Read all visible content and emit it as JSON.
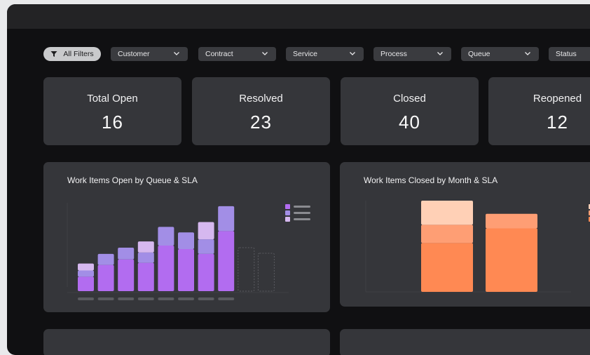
{
  "filters": {
    "all_filters_label": "All Filters",
    "dropdowns": [
      "Customer",
      "Contract",
      "Service",
      "Process",
      "Queue",
      "Status"
    ]
  },
  "kpis": [
    {
      "label": "Total Open",
      "value": "16"
    },
    {
      "label": "Resolved",
      "value": "23"
    },
    {
      "label": "Closed",
      "value": "40"
    },
    {
      "label": "Reopened",
      "value": "12"
    }
  ],
  "charts": {
    "open_by_queue": {
      "title": "Work Items Open by Queue & SLA"
    },
    "closed_by_month": {
      "title": "Work Items Closed by Month & SLA"
    }
  },
  "colors": {
    "purple_dark": "#b26cf0",
    "purple_mid": "#a28ee6",
    "purple_light": "#d6b8ef",
    "orange_dark": "#ff8953",
    "orange_mid": "#fe9e74",
    "orange_light": "#ffd0b6"
  },
  "chart_data": [
    {
      "type": "bar",
      "title": "Work Items Open by Queue & SLA",
      "categories": [
        "",
        "",
        "",
        "",
        "",
        "",
        "",
        "",
        "",
        ""
      ],
      "series": [
        {
          "values": [
            21,
            38,
            46,
            41,
            66,
            61,
            54,
            87,
            0,
            0
          ]
        },
        {
          "values": [
            9,
            16,
            17,
            15,
            27,
            24,
            21,
            36,
            0,
            0
          ]
        },
        {
          "values": [
            10,
            0,
            0,
            16,
            0,
            0,
            25,
            0,
            0,
            0
          ]
        }
      ],
      "ylim": [
        0,
        130
      ],
      "legend": "top-right"
    },
    {
      "type": "bar",
      "title": "Work Items Closed by Month & SLA",
      "categories": [
        "",
        ""
      ],
      "series": [
        {
          "values": [
            67,
            87
          ]
        },
        {
          "values": [
            25,
            20
          ]
        },
        {
          "values": [
            33,
            0
          ]
        }
      ],
      "ylim": [
        0,
        125
      ],
      "legend": "top-right"
    }
  ]
}
